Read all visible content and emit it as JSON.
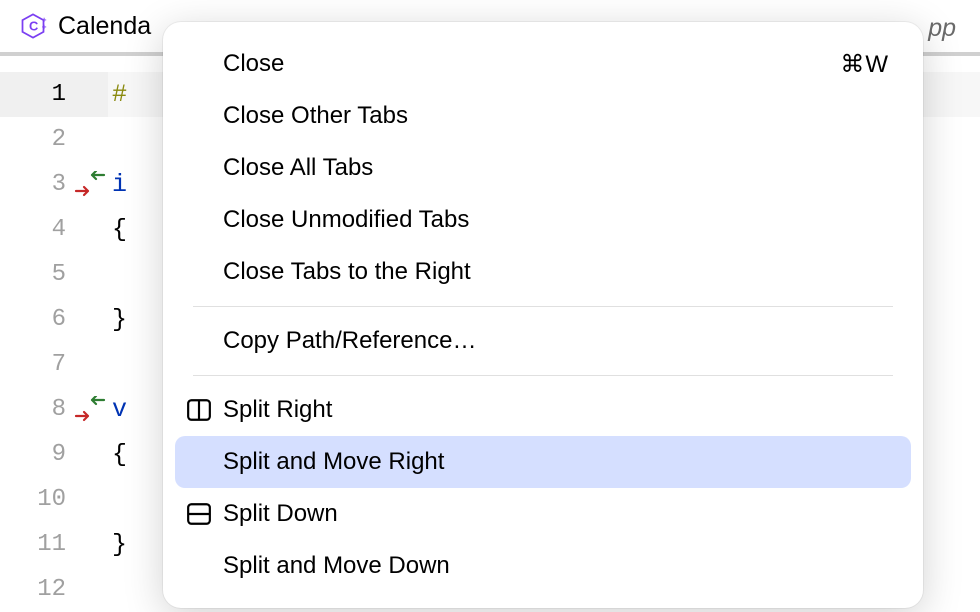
{
  "tab": {
    "title": "Calenda",
    "suffix": "pp",
    "icon_name": "cpp-file-icon"
  },
  "gutter": {
    "lines": [
      {
        "n": "1",
        "active": true
      },
      {
        "n": "2"
      },
      {
        "n": "3",
        "merge": true
      },
      {
        "n": "4"
      },
      {
        "n": "5"
      },
      {
        "n": "6"
      },
      {
        "n": "7"
      },
      {
        "n": "8",
        "merge": true
      },
      {
        "n": "9"
      },
      {
        "n": "10"
      },
      {
        "n": "11"
      },
      {
        "n": "12"
      }
    ]
  },
  "code": {
    "lines": [
      {
        "token": "#",
        "cls": "tk-preproc",
        "active": true
      },
      {
        "token": ""
      },
      {
        "token": "i",
        "cls": "tk-keyword"
      },
      {
        "token": "{",
        "cls": "tk-brace"
      },
      {
        "token": ""
      },
      {
        "token": "}",
        "cls": "tk-brace"
      },
      {
        "token": ""
      },
      {
        "token": "v",
        "cls": "tk-keyword"
      },
      {
        "token": "{",
        "cls": "tk-brace"
      },
      {
        "token": ""
      },
      {
        "token": "}",
        "cls": "tk-brace"
      },
      {
        "token": ""
      }
    ]
  },
  "menu": {
    "items": [
      {
        "label": "Close",
        "shortcut": "⌘W"
      },
      {
        "label": "Close Other Tabs"
      },
      {
        "label": "Close All Tabs"
      },
      {
        "label": "Close Unmodified Tabs"
      },
      {
        "label": "Close Tabs to the Right"
      },
      {
        "separator": true
      },
      {
        "label": "Copy Path/Reference…"
      },
      {
        "separator": true
      },
      {
        "label": "Split Right",
        "icon": "split-right-icon"
      },
      {
        "label": "Split and Move Right",
        "highlighted": true
      },
      {
        "label": "Split Down",
        "icon": "split-down-icon"
      },
      {
        "label": "Split and Move Down"
      }
    ]
  }
}
